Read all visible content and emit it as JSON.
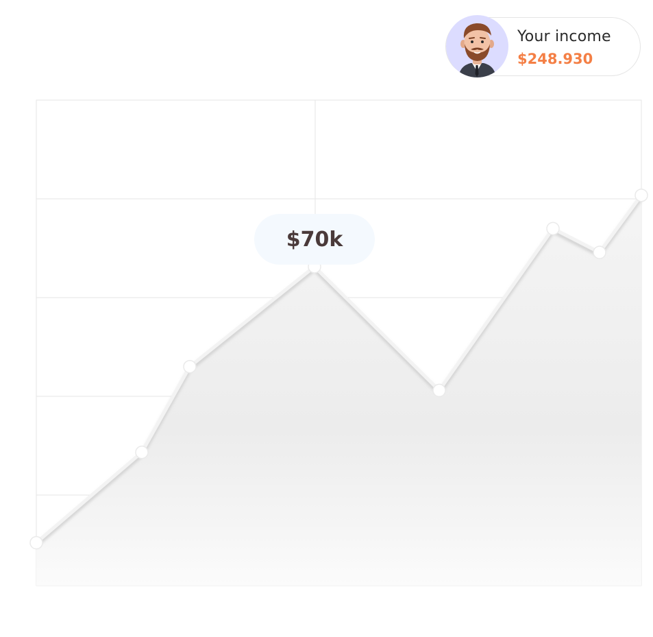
{
  "income": {
    "label": "Your income",
    "value": "$248.930"
  },
  "tooltip": {
    "value": "$70k"
  },
  "avatar": {
    "icon": "bearded-man-avatar-icon"
  },
  "colors": {
    "accent": "#f47f45",
    "avatar_bg": "#dcdcff",
    "tooltip_bg": "#f4f9fe",
    "grid": "#e6e6e6"
  },
  "chart_data": {
    "type": "area",
    "title": "",
    "xlabel": "",
    "ylabel": "",
    "grid": true,
    "x": [
      0,
      1,
      2,
      3,
      4,
      5,
      6,
      7
    ],
    "series": [
      {
        "values": [
          4,
          23,
          41,
          62,
          36,
          70,
          65,
          77
        ]
      }
    ],
    "ylim": [
      -5,
      97
    ],
    "highlight_index": 3
  }
}
